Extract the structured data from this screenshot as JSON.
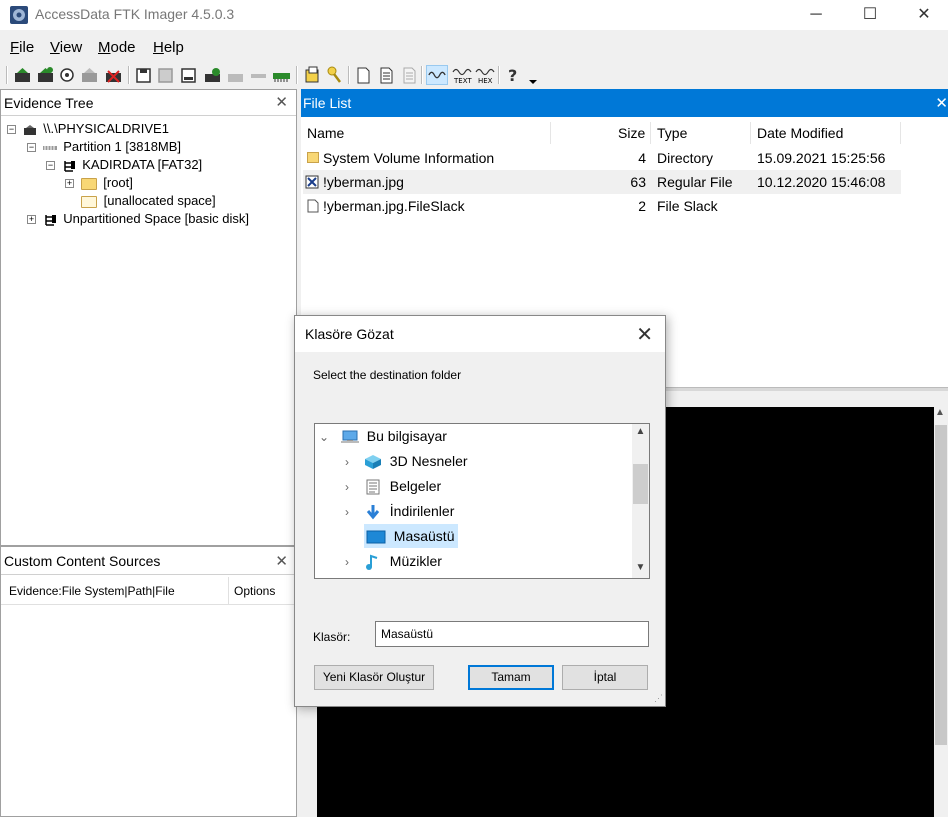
{
  "app": {
    "title": "AccessData FTK Imager 4.5.0.3",
    "menu": [
      {
        "key": "F",
        "rest": "ile"
      },
      {
        "key": "V",
        "rest": "iew"
      },
      {
        "key": "M",
        "rest": "ode"
      },
      {
        "key": "H",
        "rest": "elp"
      }
    ]
  },
  "evidence_tree": {
    "title": "Evidence Tree",
    "items": [
      {
        "label": "\\\\.\\PHYSICALDRIVE1",
        "expander": "−"
      },
      {
        "label": "Partition 1 [3818MB]",
        "expander": "−"
      },
      {
        "label": "KADIRDATA [FAT32]",
        "expander": "−"
      },
      {
        "label": "[root]",
        "expander": "+"
      },
      {
        "label": "[unallocated space]"
      },
      {
        "label": "Unpartitioned Space [basic disk]",
        "expander": "+"
      }
    ]
  },
  "custom_content": {
    "title": "Custom Content Sources",
    "col_evidence": "Evidence:File System|Path|File",
    "col_options": "Options"
  },
  "file_list": {
    "title": "File List",
    "columns": {
      "name": "Name",
      "size": "Size",
      "type": "Type",
      "date": "Date Modified"
    },
    "rows": [
      {
        "name": "System Volume Information",
        "size": "4",
        "type": "Directory",
        "date": "15.09.2021 15:25:56"
      },
      {
        "name": "!yberman.jpg",
        "size": "63",
        "type": "Regular File",
        "date": "10.12.2020 15:46:08"
      },
      {
        "name": "!yberman.jpg.FileSlack",
        "size": "2",
        "type": "File Slack",
        "date": ""
      }
    ]
  },
  "dialog": {
    "title": "Klasöre Gözat",
    "prompt": "Select the destination folder",
    "tree": [
      {
        "label": "Bu bilgisayar",
        "chevron": "down"
      },
      {
        "label": "3D Nesneler",
        "chevron": "right"
      },
      {
        "label": "Belgeler",
        "chevron": "right"
      },
      {
        "label": "İndirilenler",
        "chevron": "right"
      },
      {
        "label": "Masaüstü",
        "chevron": "none"
      },
      {
        "label": "Müzikler",
        "chevron": "right"
      }
    ],
    "folder_label": "Klasör:",
    "folder_value": "Masaüstü",
    "new_folder_button": "Yeni Klasör Oluştur",
    "ok_button": "Tamam",
    "cancel_button": "İptal"
  },
  "colors": {
    "accent": "#0078d7",
    "selection": "#cce8ff"
  }
}
